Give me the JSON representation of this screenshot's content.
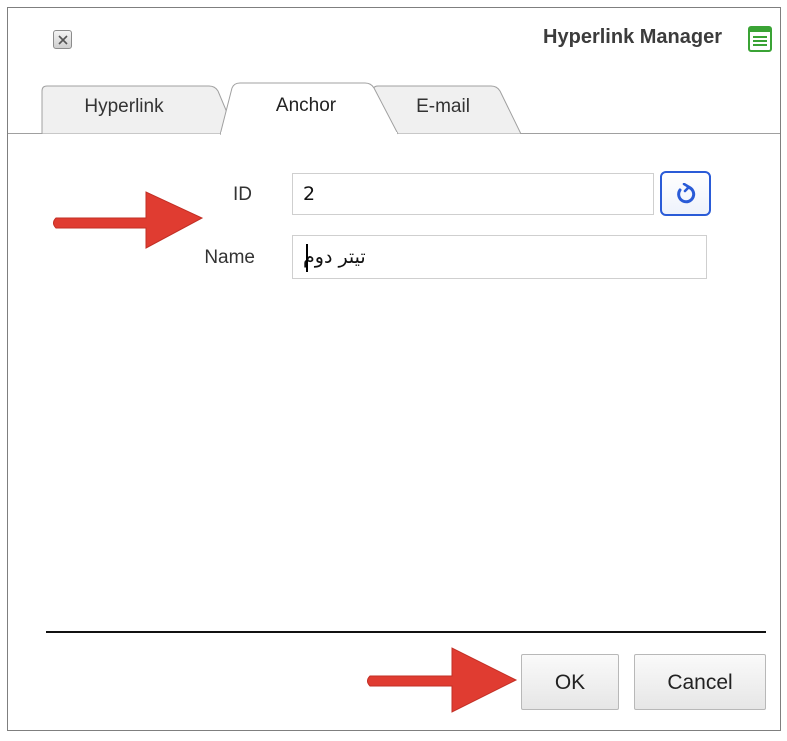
{
  "window": {
    "title": "Hyperlink Manager",
    "close_icon": "close-icon",
    "title_icon": "hyperlink-manager-icon"
  },
  "tabs": [
    {
      "label": "Hyperlink",
      "active": false
    },
    {
      "label": "Anchor",
      "active": true
    },
    {
      "label": "E-mail",
      "active": false
    }
  ],
  "form": {
    "id_label": "ID",
    "id_value": "2",
    "regenerate_icon": "refresh-icon",
    "name_label": "Name",
    "name_value": "تیتر دوم"
  },
  "buttons": {
    "ok_label": "OK",
    "cancel_label": "Cancel"
  },
  "annotations": {
    "arrow_color": "#e03c31",
    "arrow_icon": "red-arrow-icon"
  },
  "colors": {
    "accent_blue": "#2a5bd7",
    "title_icon_green": "#3aa335"
  }
}
